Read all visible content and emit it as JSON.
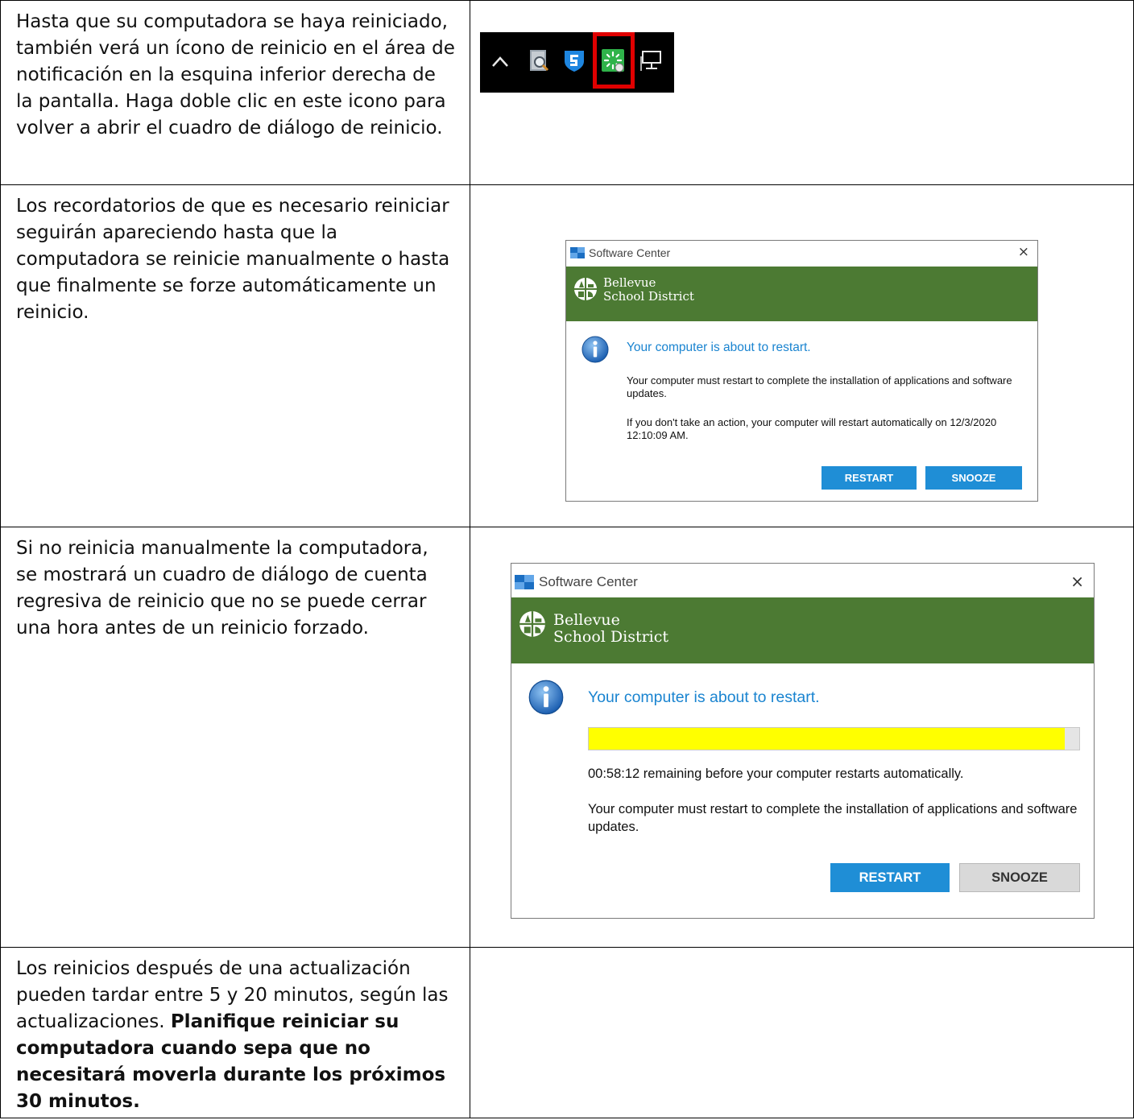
{
  "rows": [
    {
      "text": "Hasta que su computadora se haya reiniciado, también verá un ícono de reinicio en el área de notificación en la esquina inferior derecha de la pantalla. Haga doble clic en este icono para volver a abrir el cuadro de diálogo de reinicio."
    },
    {
      "text": "Los recordatorios de que es necesario reiniciar seguirán apareciendo hasta que la computadora se reinicie manualmente o hasta que finalmente se forze automáticamente un reinicio."
    },
    {
      "text": "Si no reinicia manualmente la computadora, se mostrará un cuadro de diálogo de cuenta regresiva de reinicio que no se puede cerrar una hora antes de un reinicio forzado."
    },
    {
      "text_plain": "Los reinicios después de una actualización pueden tardar entre 5 y 20 minutos, según las actualizaciones. ",
      "text_bold": "Planifique reiniciar su computadora cuando sepa que no necesitará moverla durante los próximos 30 minutos."
    }
  ],
  "tray": {
    "icons": [
      "chevron-up-icon",
      "disk-search-icon",
      "shield-s-icon",
      "restart-pending-icon",
      "network-monitor-icon"
    ],
    "highlight_color": "#e00000"
  },
  "dialog1": {
    "title": "Software Center",
    "close": "×",
    "brand_line1": "Bellevue",
    "brand_line2": "School District",
    "heading": "Your computer is about to restart.",
    "body1": "Your computer must restart to complete the installation of applications and software updates.",
    "body2": "If you don't take an action, your computer will restart automatically on 12/3/2020 12:10:09 AM.",
    "restart_label": "RESTART",
    "snooze_label": "SNOOZE"
  },
  "dialog2": {
    "title": "Software Center",
    "close": "×",
    "brand_line1": "Bellevue",
    "brand_line2": "School District",
    "heading": "Your computer is about to restart.",
    "progress": 0.97,
    "remaining": "00:58:12 remaining before your computer restarts automatically.",
    "body1": "Your computer must restart to complete the installation of applications and software updates.",
    "restart_label": "RESTART",
    "snooze_label": "SNOOZE"
  },
  "colors": {
    "banner": "#4c7a33",
    "accent_blue": "#1a84d0",
    "button_blue": "#1f8ed6",
    "progress_fill": "#ffff00"
  }
}
